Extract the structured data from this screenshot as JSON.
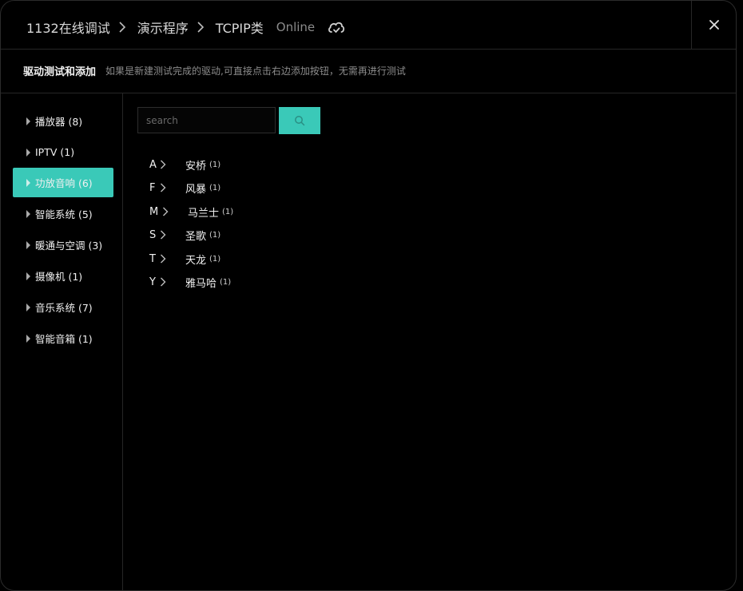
{
  "breadcrumb": {
    "items": [
      "1132在线调试",
      "演示程序",
      "TCPIP类"
    ],
    "status": "Online"
  },
  "icons": {
    "status": "cloud-check-icon",
    "close": "close-icon",
    "search": "search-icon",
    "expand": "caret-right-icon",
    "brand_expand": "chevron-right-icon"
  },
  "subheader": {
    "title": "驱动测试和添加",
    "description": "如果是新建测试完成的驱动,可直接点击右边添加按钮，无需再进行测试"
  },
  "sidebar": {
    "items": [
      {
        "label": "播放器 (8)",
        "active": false
      },
      {
        "label": "IPTV (1)",
        "active": false
      },
      {
        "label": "功放音响 (6)",
        "active": true
      },
      {
        "label": "智能系统 (5)",
        "active": false
      },
      {
        "label": "暖通与空调 (3)",
        "active": false
      },
      {
        "label": "摄像机 (1)",
        "active": false
      },
      {
        "label": "音乐系统 (7)",
        "active": false
      },
      {
        "label": "智能音箱 (1)",
        "active": false
      }
    ]
  },
  "search": {
    "placeholder": "search",
    "value": ""
  },
  "brands": [
    {
      "letter": "A",
      "name": "安桥",
      "count": "(1)"
    },
    {
      "letter": "F",
      "name": "风暴",
      "count": "(1)"
    },
    {
      "letter": "M",
      "name": "马兰士",
      "count": "(1)"
    },
    {
      "letter": "S",
      "name": "圣歌",
      "count": "(1)"
    },
    {
      "letter": "T",
      "name": "天龙",
      "count": "(1)"
    },
    {
      "letter": "Y",
      "name": "雅马哈",
      "count": "(1)"
    }
  ],
  "colors": {
    "accent": "#3ac9b8",
    "background": "#000000",
    "border": "#262626"
  }
}
